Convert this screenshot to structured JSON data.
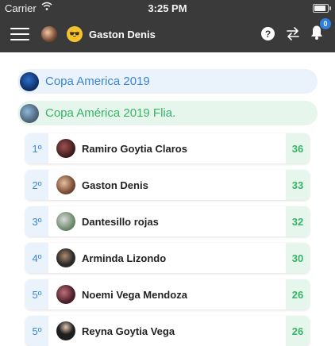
{
  "status_bar": {
    "carrier": "Carrier",
    "time": "3:25 PM",
    "battery_level": 0.9
  },
  "header": {
    "user_name": "Gaston Denis",
    "emoji": "😎",
    "help_label": "?",
    "notification_count": "0",
    "icons": [
      "menu-icon",
      "avatar",
      "emoji-avatar",
      "help-icon",
      "swap-icon",
      "bell-icon"
    ]
  },
  "groups": [
    {
      "label": "Copa America 2019",
      "color": "#3a86d4"
    },
    {
      "label": "Copa América 2019 Flia.",
      "color": "#35b566"
    }
  ],
  "ranking": [
    {
      "position": "1º",
      "name": "Ramiro Goytia Claros",
      "score": "36"
    },
    {
      "position": "2º",
      "name": "Gaston Denis",
      "score": "33"
    },
    {
      "position": "3º",
      "name": "Dantesillo rojas",
      "score": "32"
    },
    {
      "position": "4º",
      "name": "Arminda Lizondo",
      "score": "30"
    },
    {
      "position": "5º",
      "name": "Noemi Vega Mendoza",
      "score": "26"
    },
    {
      "position": "5º",
      "name": "Reyna Goytia Vega",
      "score": "26"
    }
  ],
  "colors": {
    "header_bg": "#3a3a3a",
    "blue_accent": "#3a86d4",
    "green_accent": "#35b566"
  }
}
